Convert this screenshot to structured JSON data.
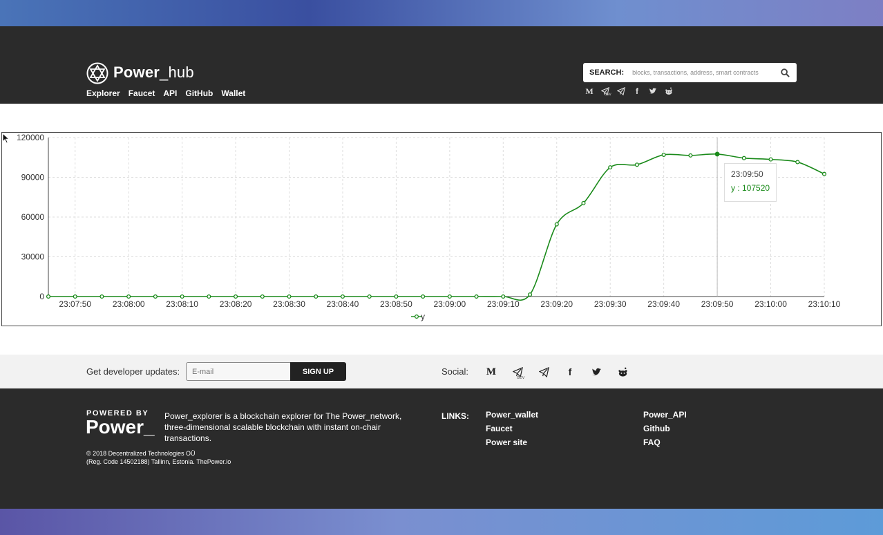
{
  "brand": {
    "name_bold": "Power",
    "name_thin": "_hub"
  },
  "nav": [
    "Explorer",
    "Faucet",
    "API",
    "GitHub",
    "Wallet"
  ],
  "search": {
    "label": "SEARCH:",
    "placeholder": "blocks, transactions, address, smart contracts"
  },
  "header_social": {
    "medium_glyph": "M",
    "dev_tag": "dev"
  },
  "tooltip": {
    "time": "23:09:50",
    "value_text": "y : 107520"
  },
  "chart_data": {
    "type": "line",
    "x": [
      "23:07:45",
      "23:07:50",
      "23:07:55",
      "23:08:00",
      "23:08:05",
      "23:08:10",
      "23:08:15",
      "23:08:20",
      "23:08:25",
      "23:08:30",
      "23:08:35",
      "23:08:40",
      "23:08:45",
      "23:08:50",
      "23:08:55",
      "23:09:00",
      "23:09:05",
      "23:09:10",
      "23:09:15",
      "23:09:20",
      "23:09:25",
      "23:09:30",
      "23:09:35",
      "23:09:40",
      "23:09:45",
      "23:09:50",
      "23:09:55",
      "23:10:00",
      "23:10:05",
      "23:10:10"
    ],
    "series": [
      {
        "name": "y",
        "color": "#1a8a1a",
        "values": [
          0,
          0,
          0,
          0,
          0,
          0,
          0,
          0,
          0,
          0,
          0,
          0,
          0,
          0,
          0,
          0,
          0,
          0,
          1500,
          54500,
          70500,
          97500,
          99500,
          107000,
          106500,
          107520,
          104500,
          103500,
          101500,
          92500
        ]
      }
    ],
    "xticks": [
      "23:07:50",
      "23:08:00",
      "23:08:10",
      "23:08:20",
      "23:08:30",
      "23:08:40",
      "23:08:50",
      "23:09:00",
      "23:09:10",
      "23:09:20",
      "23:09:30",
      "23:09:40",
      "23:09:50",
      "23:10:00",
      "23:10:10"
    ],
    "yticks": [
      "120000",
      "90000",
      "60000",
      "30000",
      "0"
    ],
    "ylim": [
      0,
      120000
    ],
    "grid": true,
    "legend": "bottom-center",
    "highlight_index": 25
  },
  "updates": {
    "label": "Get developer updates:",
    "email_placeholder": "E-mail",
    "signup": "SIGN UP",
    "social_label": "Social:"
  },
  "footer_social": {
    "medium_glyph": "M",
    "dev_tag": "dev"
  },
  "footer": {
    "powered_by": "POWERED BY",
    "power_logo": "Power_",
    "about": "Power_explorer is a blockchain explorer for The Power_network, three-dimensional scalable blockchain with instant on-chair transactions.",
    "copyright_1": "© 2018 Decentralized Technologies OÜ",
    "copyright_2": "(Reg. Code 14502188) Tallinn, Estonia. ThePower.io",
    "links_label": "LINKS:",
    "links_col1": [
      "Power_wallet",
      "Faucet",
      "Power site"
    ],
    "links_col2": [
      "Power_API",
      "Github",
      "FAQ"
    ]
  }
}
